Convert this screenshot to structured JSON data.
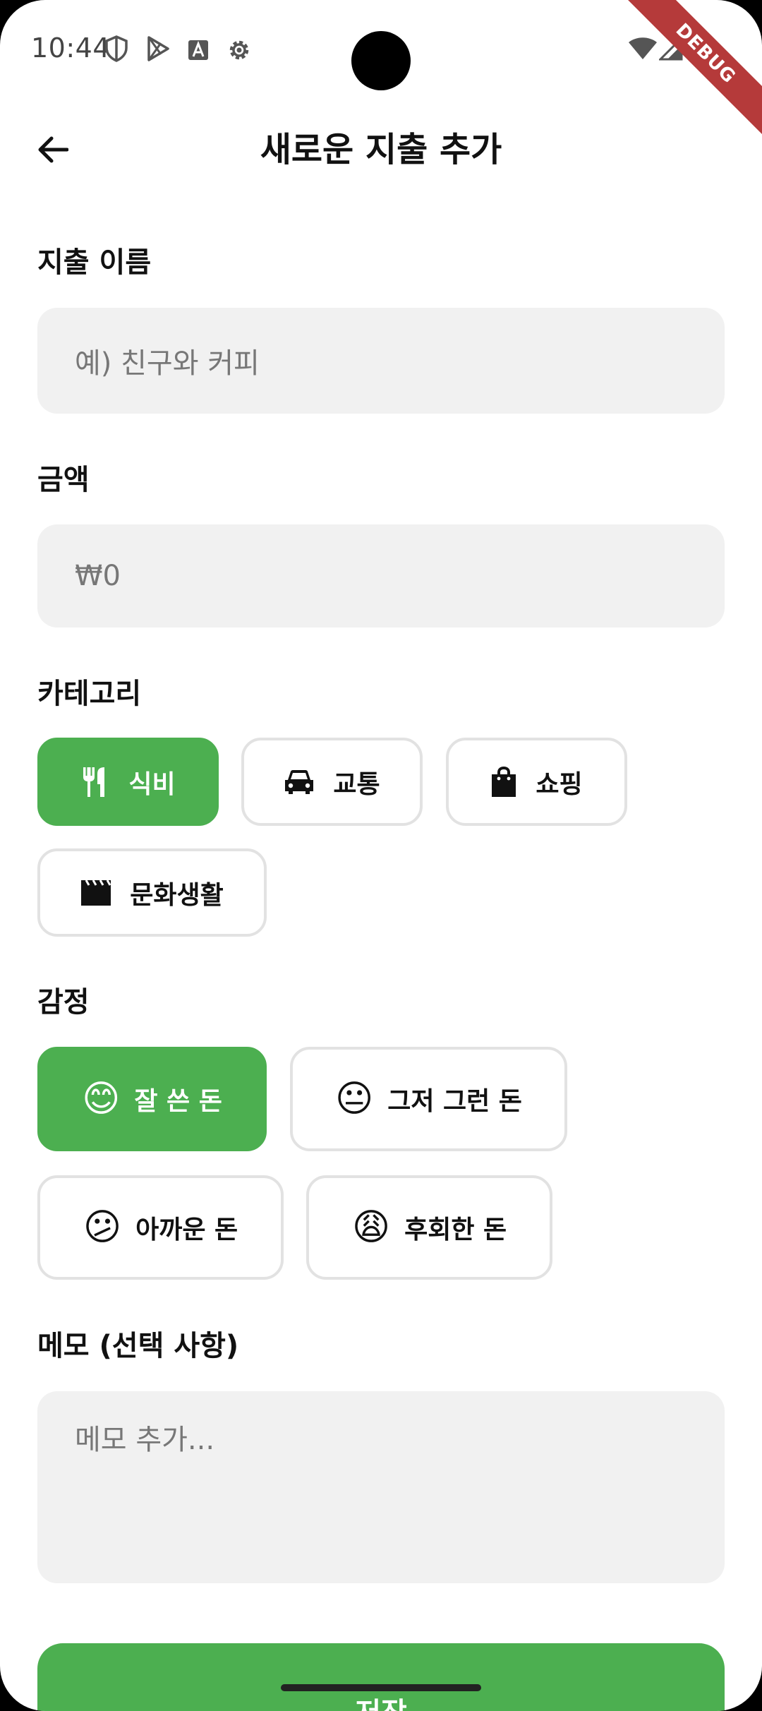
{
  "status_bar": {
    "time": "10:44",
    "debug_label": "DEBUG"
  },
  "header": {
    "title": "새로운 지출 추가"
  },
  "form": {
    "name_label": "지출 이름",
    "name_placeholder": "예) 친구와 커피",
    "amount_label": "금액",
    "amount_placeholder": "₩0",
    "category_label": "카테고리",
    "categories": [
      {
        "label": "식비",
        "icon": "fork-knife-icon",
        "selected": true
      },
      {
        "label": "교통",
        "icon": "car-icon",
        "selected": false
      },
      {
        "label": "쇼핑",
        "icon": "shopping-bag-icon",
        "selected": false
      },
      {
        "label": "문화생활",
        "icon": "movie-clapper-icon",
        "selected": false
      }
    ],
    "emotion_label": "감정",
    "emotions": [
      {
        "label": "잘 쓴 돈",
        "emoji": "😊",
        "selected": true
      },
      {
        "label": "그저 그런 돈",
        "emoji": "😐",
        "selected": false
      },
      {
        "label": "아까운 돈",
        "emoji": "😕",
        "selected": false
      },
      {
        "label": "후회한 돈",
        "emoji": "😩",
        "selected": false
      }
    ],
    "memo_label": "메모 (선택 사항)",
    "memo_placeholder": "메모 추가..."
  },
  "save_label": "저장",
  "colors": {
    "accent": "#4caf50",
    "field_bg": "#f1f1f1",
    "chip_border": "#e2e2e2",
    "debug": "#b53a3a"
  }
}
